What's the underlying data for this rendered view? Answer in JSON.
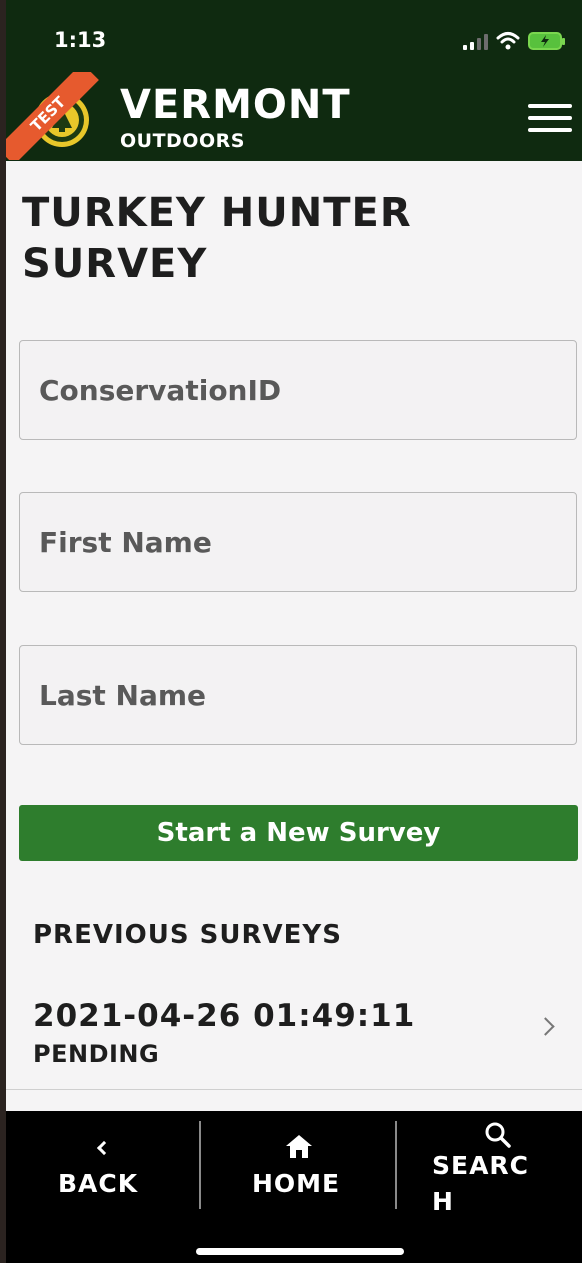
{
  "status_bar": {
    "time": "1:13"
  },
  "header": {
    "badge": "TEST",
    "brand_title": "VERMONT",
    "brand_subtitle": "OUTDOORS",
    "menu_icon": "hamburger-menu-icon"
  },
  "page": {
    "title": "TURKEY HUNTER SURVEY"
  },
  "form": {
    "conservation_id": {
      "placeholder": "ConservationID",
      "value": ""
    },
    "first_name": {
      "placeholder": "First Name",
      "value": ""
    },
    "last_name": {
      "placeholder": "Last Name",
      "value": ""
    },
    "start_button": "Start a New Survey"
  },
  "previous_surveys": {
    "heading": "PREVIOUS SURVEYS",
    "items": [
      {
        "date": "2021-04-26 01:49:11",
        "status": "PENDING"
      }
    ]
  },
  "bottom_nav": {
    "back": "BACK",
    "home": "HOME",
    "search_line1": "SEARC",
    "search_line2": "H"
  },
  "colors": {
    "header_bg": "#0f2a10",
    "accent_green": "#2e7d2d",
    "test_badge": "#e65a2e",
    "nav_bg": "#000000"
  }
}
